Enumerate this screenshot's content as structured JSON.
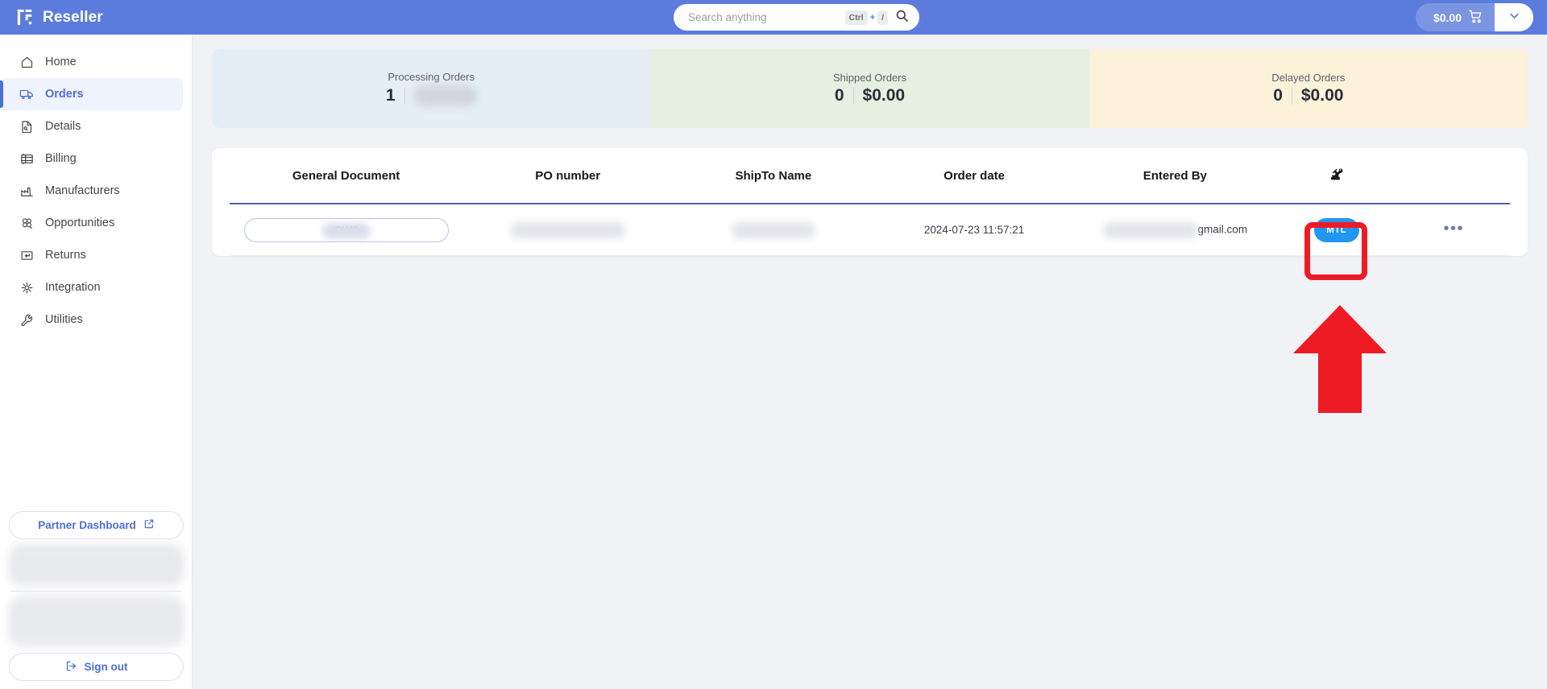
{
  "topbar": {
    "brand": "Reseller",
    "brand_logo_icon": "reseller-logo-icon",
    "search": {
      "placeholder": "Search anything",
      "value": "",
      "shortcut_key": "Ctrl",
      "shortcut_plus": "+",
      "shortcut_slash": "/",
      "icon": "search-icon"
    },
    "cart": {
      "amount": "$0.00",
      "icon": "cart-icon",
      "caret_icon": "chevron-down-icon"
    },
    "background_color": "#5b7cdc"
  },
  "sidebar": {
    "items": [
      {
        "label": "Home",
        "icon": "home-icon",
        "active": false
      },
      {
        "label": "Orders",
        "icon": "truck-icon",
        "active": true
      },
      {
        "label": "Details",
        "icon": "document-icon",
        "active": false
      },
      {
        "label": "Billing",
        "icon": "invoice-icon",
        "active": false
      },
      {
        "label": "Manufacturers",
        "icon": "factory-icon",
        "active": false
      },
      {
        "label": "Opportunities",
        "icon": "clover-icon",
        "active": false
      },
      {
        "label": "Returns",
        "icon": "return-arrow-icon",
        "active": false
      },
      {
        "label": "Integration",
        "icon": "integration-icon",
        "active": false
      },
      {
        "label": "Utilities",
        "icon": "wrench-icon",
        "active": false
      }
    ],
    "partner_dashboard": {
      "label": "Partner Dashboard",
      "icon": "external-link-icon"
    },
    "sign_out": {
      "label": "Sign out",
      "icon": "sign-out-icon"
    },
    "active_color": "#4d6fd6"
  },
  "stats": [
    {
      "label": "Processing Orders",
      "count": "1",
      "amount": "",
      "amount_redacted": true,
      "background_color": "#e4eef5"
    },
    {
      "label": "Shipped Orders",
      "count": "0",
      "amount": "$0.00",
      "amount_redacted": false,
      "background_color": "#e4f1e0"
    },
    {
      "label": "Delayed Orders",
      "count": "0",
      "amount": "$0.00",
      "amount_redacted": false,
      "background_color": "#fcf1d9"
    }
  ],
  "table": {
    "columns": [
      {
        "label": "General Document",
        "icon": ""
      },
      {
        "label": "PO number",
        "icon": ""
      },
      {
        "label": "ShipTo Name",
        "icon": ""
      },
      {
        "label": "Order date",
        "icon": ""
      },
      {
        "label": "Entered By",
        "icon": ""
      },
      {
        "label": "",
        "icon": "robot-arm-icon"
      },
      {
        "label": "",
        "icon": ""
      }
    ],
    "rows": [
      {
        "general_document": "OW0",
        "general_document_redacted": true,
        "po_number": "",
        "po_number_redacted": true,
        "shipto_name": "",
        "shipto_name_redacted": true,
        "order_date": "2024-07-23 11:57:21",
        "entered_by": "gmail.com",
        "entered_by_redacted": true,
        "badge": "MTL",
        "badge_color": "#2196f3",
        "actions_icon": "more-horizontal-icon"
      }
    ]
  },
  "annotations": {
    "highlight_box_color": "#ee1b24",
    "arrow_color": "#ee1b24",
    "arrow_icon": "up-arrow-annotation",
    "target": "MTL"
  }
}
